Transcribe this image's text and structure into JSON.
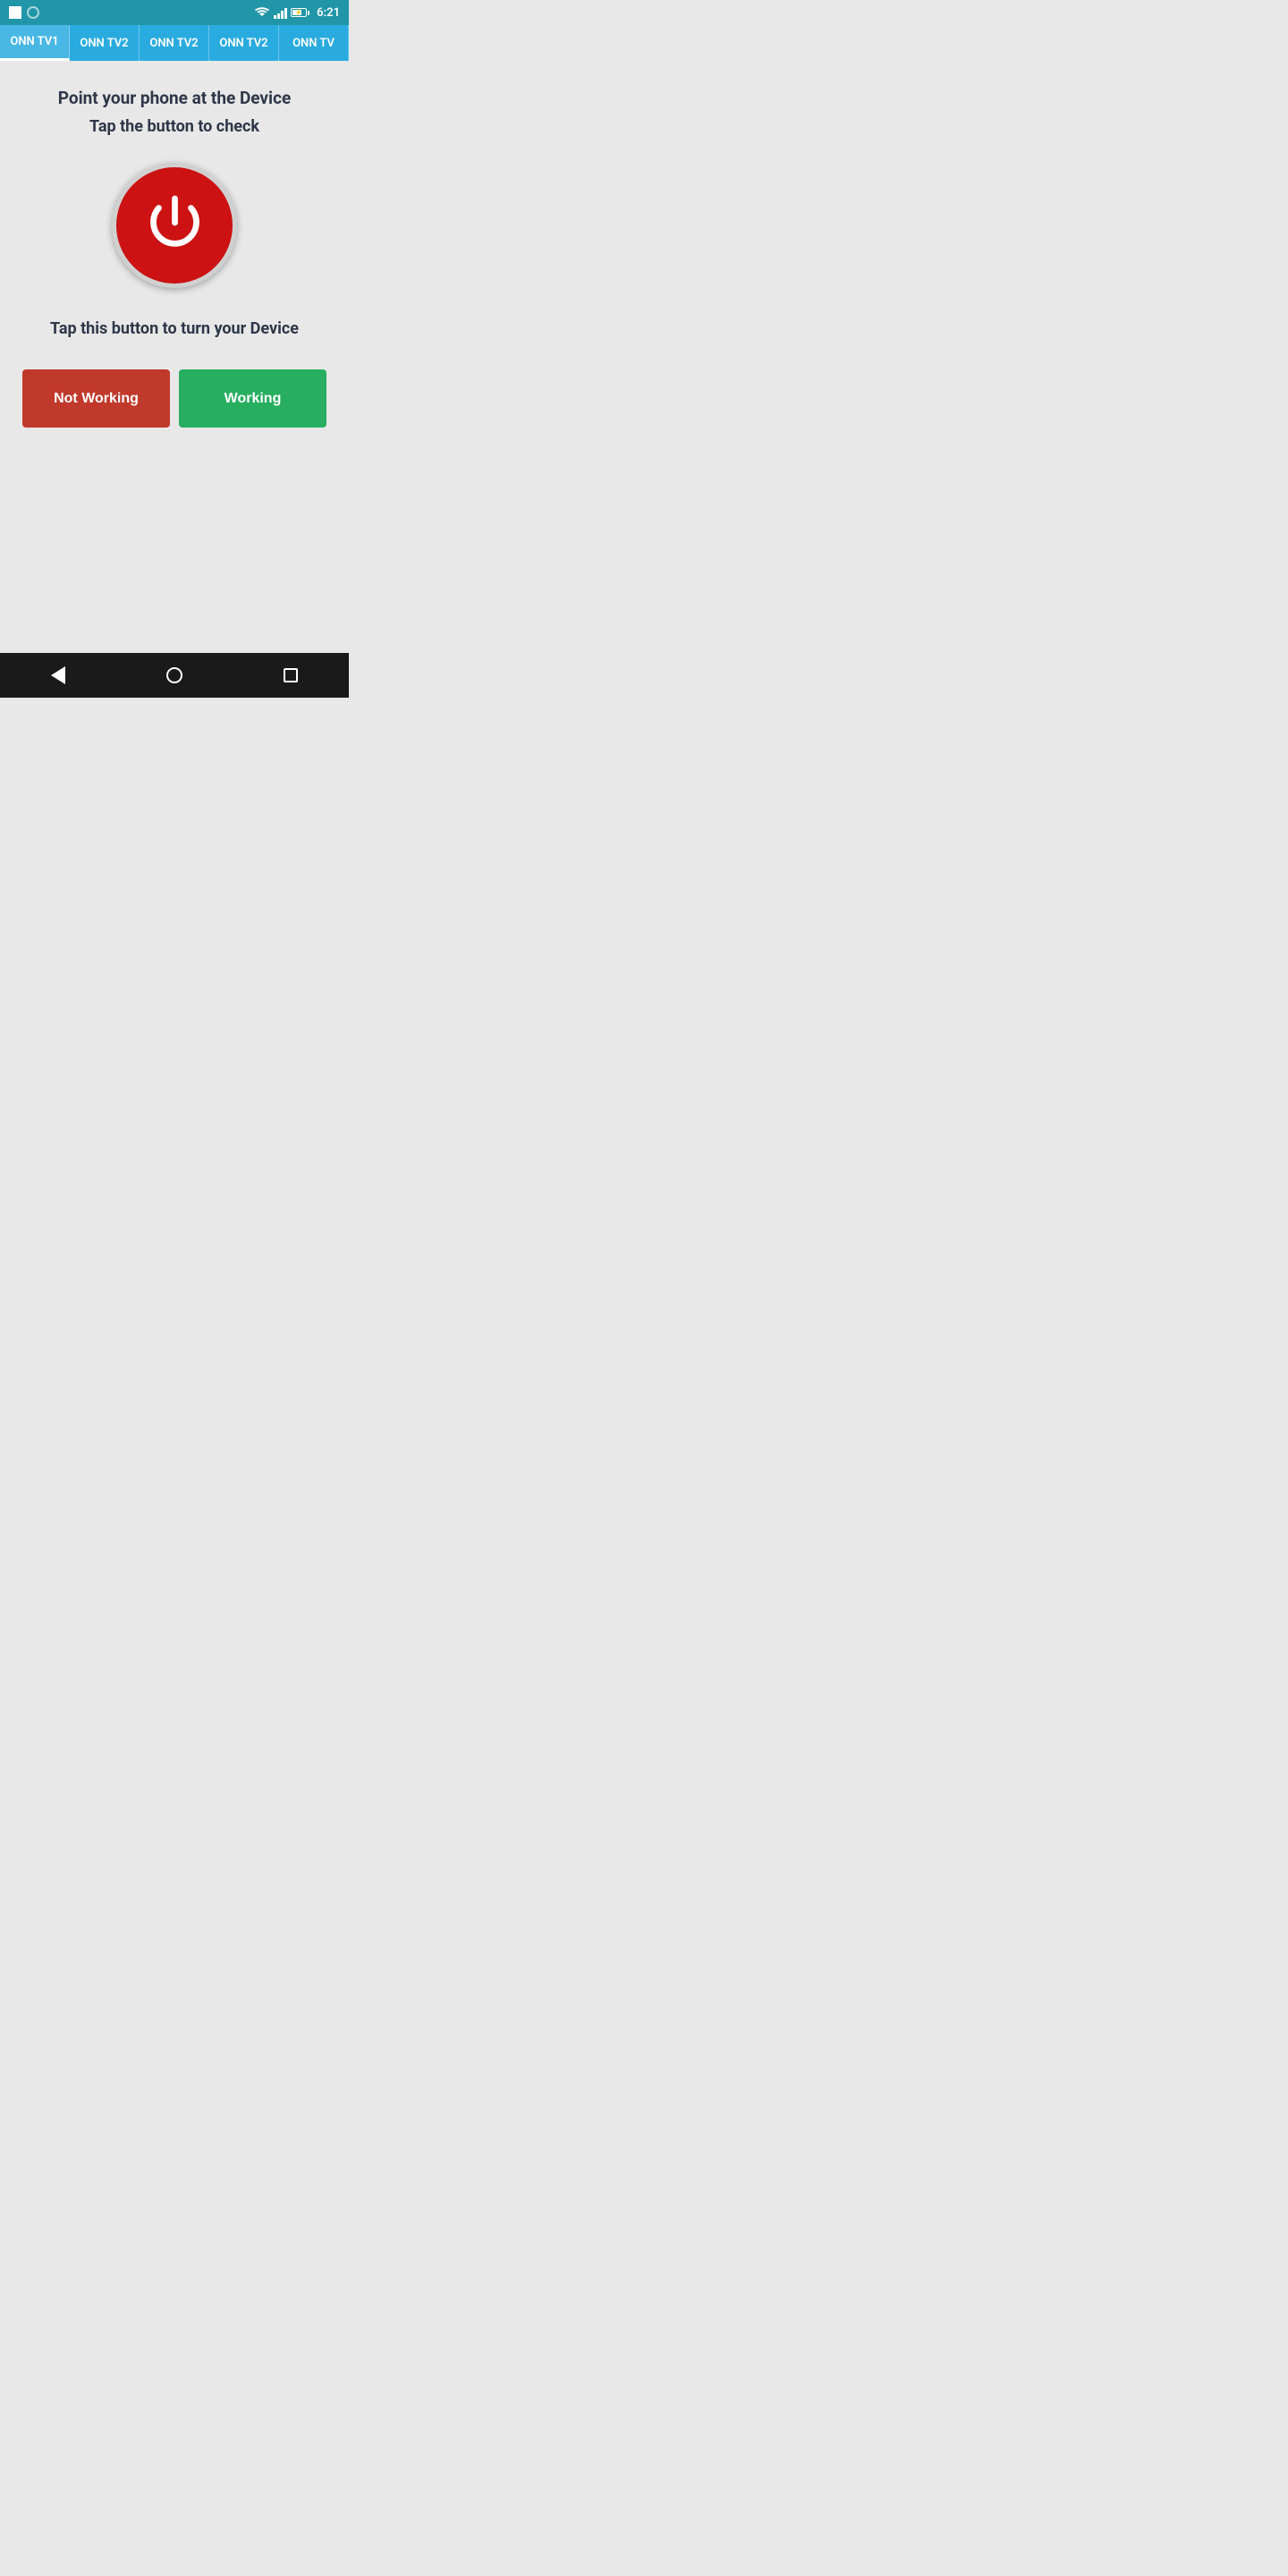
{
  "statusBar": {
    "time": "6:21",
    "icons": {
      "wifi": "wifi-icon",
      "signal": "signal-icon",
      "battery": "battery-icon"
    }
  },
  "tabs": [
    {
      "label": "ONN TV1",
      "active": true
    },
    {
      "label": "ONN TV2",
      "active": false
    },
    {
      "label": "ONN TV2",
      "active": false
    },
    {
      "label": "ONN TV2",
      "active": false
    },
    {
      "label": "ONN TV",
      "active": false
    }
  ],
  "main": {
    "instruction1": "Point your phone at the Device",
    "instruction2": "Tap the button to check",
    "deviceInstruction": "Tap this button to turn your Device",
    "notWorkingLabel": "Not Working",
    "workingLabel": "Working",
    "colors": {
      "notWorking": "#c0392b",
      "working": "#27ae60",
      "power": "#cc1212"
    }
  },
  "navBar": {
    "backLabel": "back",
    "homeLabel": "home",
    "recentLabel": "recent"
  }
}
